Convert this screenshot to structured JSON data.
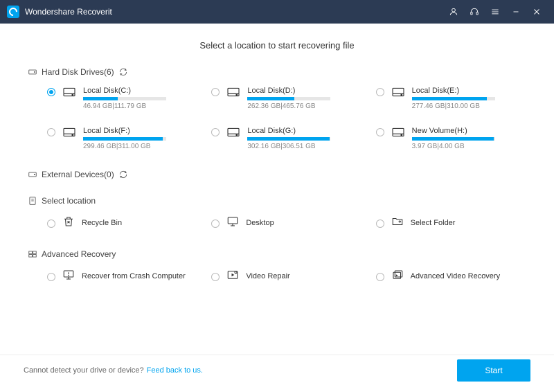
{
  "titlebar": {
    "title": "Wondershare Recoverit"
  },
  "heading": "Select a location to start recovering file",
  "sections": {
    "hdd": {
      "label": "Hard Disk Drives(6)",
      "drives": [
        {
          "label": "Local Disk(C:)",
          "used": 46.94,
          "total": 111.79,
          "sizeText": "46.94 GB|111.79 GB",
          "selected": true
        },
        {
          "label": "Local Disk(D:)",
          "used": 262.36,
          "total": 465.76,
          "sizeText": "262.36 GB|465.76 GB",
          "selected": false
        },
        {
          "label": "Local Disk(E:)",
          "used": 277.46,
          "total": 310.0,
          "sizeText": "277.46 GB|310.00 GB",
          "selected": false
        },
        {
          "label": "Local Disk(F:)",
          "used": 299.46,
          "total": 311.0,
          "sizeText": "299.46 GB|311.00 GB",
          "selected": false
        },
        {
          "label": "Local Disk(G:)",
          "used": 302.16,
          "total": 306.51,
          "sizeText": "302.16 GB|306.51 GB",
          "selected": false
        },
        {
          "label": "New Volume(H:)",
          "used": 3.97,
          "total": 4.0,
          "sizeText": "3.97 GB|4.00 GB",
          "selected": false
        }
      ]
    },
    "external": {
      "label": "External Devices(0)"
    },
    "select_location": {
      "label": "Select location",
      "items": [
        {
          "label": "Recycle Bin",
          "icon": "recycle-bin-icon"
        },
        {
          "label": "Desktop",
          "icon": "desktop-icon"
        },
        {
          "label": "Select Folder",
          "icon": "folder-icon"
        }
      ]
    },
    "advanced": {
      "label": "Advanced Recovery",
      "items": [
        {
          "label": "Recover from Crash Computer",
          "icon": "crash-icon"
        },
        {
          "label": "Video Repair",
          "icon": "video-repair-icon"
        },
        {
          "label": "Advanced Video Recovery",
          "icon": "advanced-video-icon"
        }
      ]
    }
  },
  "footer": {
    "text": "Cannot detect your drive or device?",
    "link": "Feed back to us.",
    "startLabel": "Start"
  }
}
